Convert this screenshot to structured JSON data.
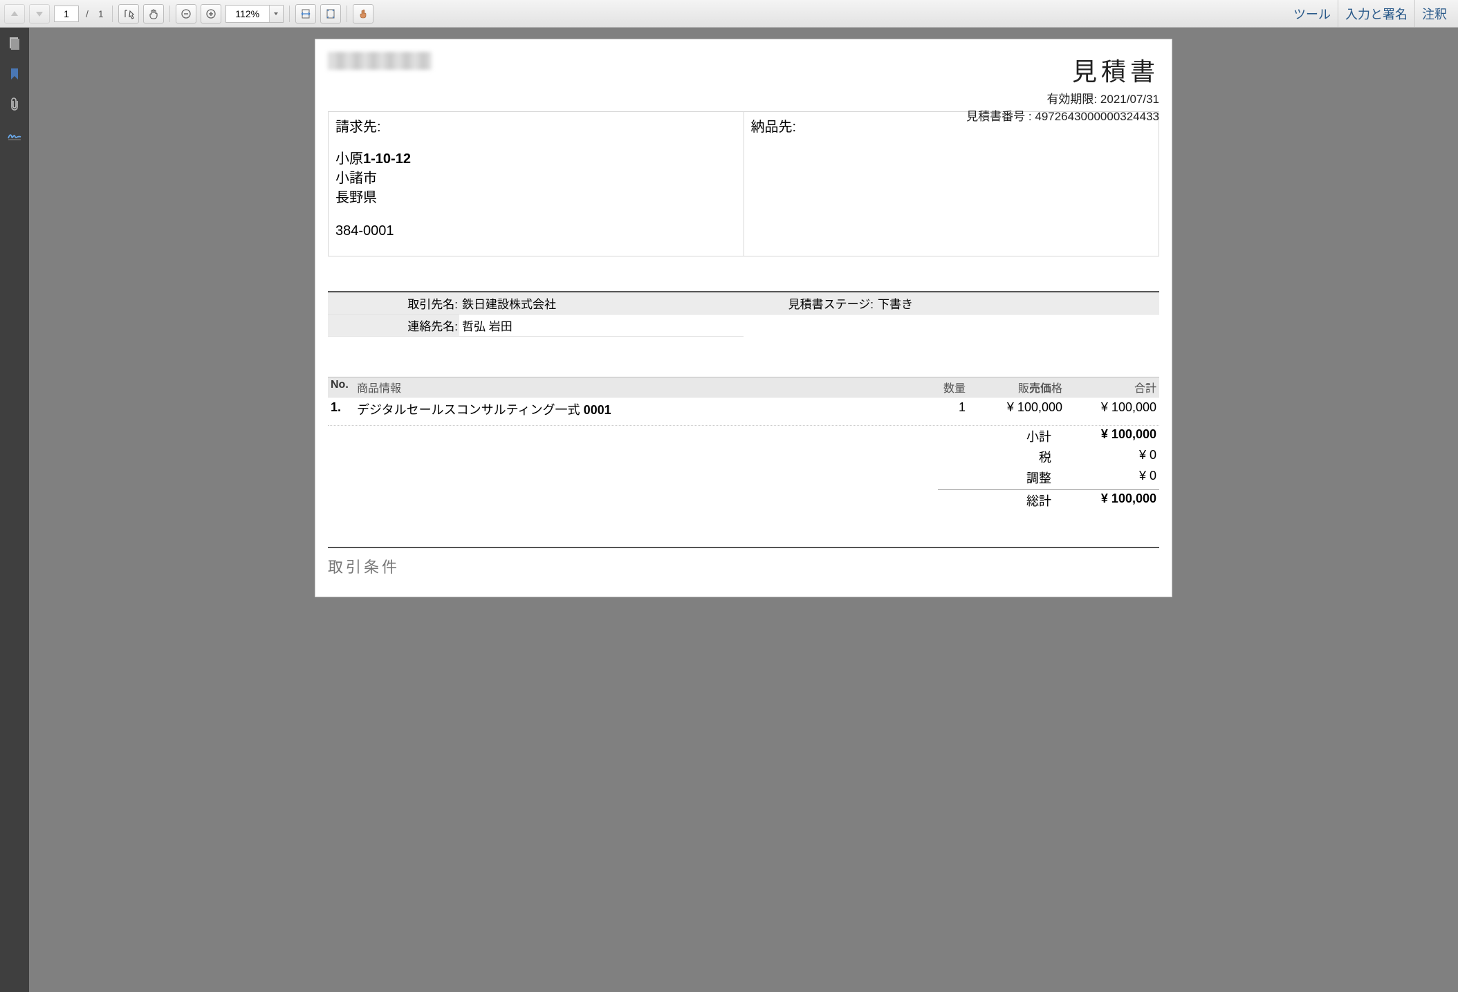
{
  "toolbar": {
    "page_current": "1",
    "page_sep": "/",
    "page_total": "1",
    "zoom": "112%",
    "links": {
      "tools": "ツール",
      "fill_sign": "入力と署名",
      "comment": "注釈"
    }
  },
  "document": {
    "title": "見積書",
    "expiry_label": "有効期限:",
    "expiry_value": "2021/07/31",
    "quote_no_label": "見積書番号 :",
    "quote_no_value": "4972643000000324433",
    "bill_to_label": "請求先:",
    "ship_to_label": "納品先:",
    "bill_to": {
      "line1_a": "小原",
      "line1_b": "1-10-12",
      "line2": "小諸市",
      "line3": "長野県",
      "line4": "384-0001"
    },
    "meta": {
      "account_label": "取引先名:",
      "account_value": "鉄日建設株式会社",
      "contact_label": "連絡先名:",
      "contact_value": "哲弘 岩田",
      "stage_label": "見積書ステージ:",
      "stage_value": "下書き"
    },
    "items_header": {
      "no": "No.",
      "info": "商品情報",
      "qty": "数量",
      "price_a": "販",
      "price_b": "売価",
      "price_c": "格",
      "total": "合計"
    },
    "items": [
      {
        "no": "1.",
        "name_a": "デジタルセールスコンサルティング一式 ",
        "name_b": "0001",
        "qty": "1",
        "price": "¥ 100,000",
        "total": "¥ 100,000"
      }
    ],
    "totals": {
      "subtotal_label": "小計",
      "subtotal_value": "¥ 100,000",
      "tax_label": "税",
      "tax_value": "¥ 0",
      "adjust_label": "調整",
      "adjust_value": "¥ 0",
      "grand_label": "総計",
      "grand_value": "¥ 100,000"
    },
    "terms_heading": "取引条件"
  }
}
